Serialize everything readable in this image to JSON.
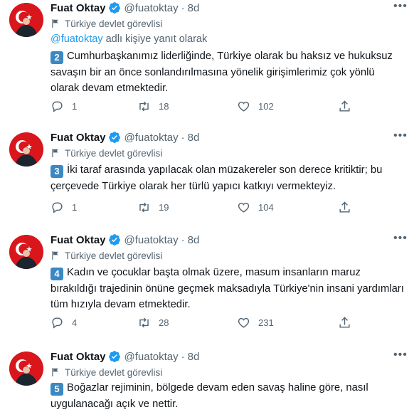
{
  "tweets": [
    {
      "name": "Fuat Oktay",
      "handle": "@fuatoktay",
      "dot": "·",
      "time": "8d",
      "label": "Türkiye devlet görevlisi",
      "reply_mention": "@fuatoktay",
      "reply_suffix": " adlı kişiye yanıt olarak",
      "number": "2",
      "text": "Cumhurbaşkanımız liderliğinde, Türkiye olarak bu haksız ve hukuksuz savaşın bir an önce sonlandırılmasına yönelik girişimlerimiz çok yönlü olarak devam etmektedir.",
      "replies": "1",
      "retweets": "18",
      "likes": "102"
    },
    {
      "name": "Fuat Oktay",
      "handle": "@fuatoktay",
      "dot": "·",
      "time": "8d",
      "label": "Türkiye devlet görevlisi",
      "number": "3",
      "text": "İki taraf arasında yapılacak olan müzakereler son derece kritiktir; bu çerçevede Türkiye olarak her türlü yapıcı katkıyı vermekteyiz.",
      "replies": "1",
      "retweets": "19",
      "likes": "104"
    },
    {
      "name": "Fuat Oktay",
      "handle": "@fuatoktay",
      "dot": "·",
      "time": "8d",
      "label": "Türkiye devlet görevlisi",
      "number": "4",
      "text": "Kadın ve çocuklar başta olmak üzere, masum insanların maruz bırakıldığı trajedinin önüne geçmek maksadıyla Türkiye'nin insani yardımları tüm hızıyla devam etmektedir.",
      "replies": "4",
      "retweets": "28",
      "likes": "231"
    },
    {
      "name": "Fuat Oktay",
      "handle": "@fuatoktay",
      "dot": "·",
      "time": "8d",
      "label": "Türkiye devlet görevlisi",
      "number": "5",
      "text": "Boğazlar rejiminin, bölgede devam eden savaş haline göre, nasıl uygulanacağı açık ve nettir."
    }
  ],
  "icons": {
    "avatar": "turkish-flag-avatar",
    "verified": "verified-badge-icon",
    "label": "flag-icon",
    "more": "more-icon",
    "reply": "reply-icon",
    "retweet": "retweet-icon",
    "like": "heart-icon",
    "share": "share-icon"
  },
  "colors": {
    "avatar_bg": "#d9161c",
    "verified": "#1d9bf0",
    "mention": "#1d9bf0",
    "number_badge": "#3b88c3",
    "secondary_text": "#536471"
  }
}
